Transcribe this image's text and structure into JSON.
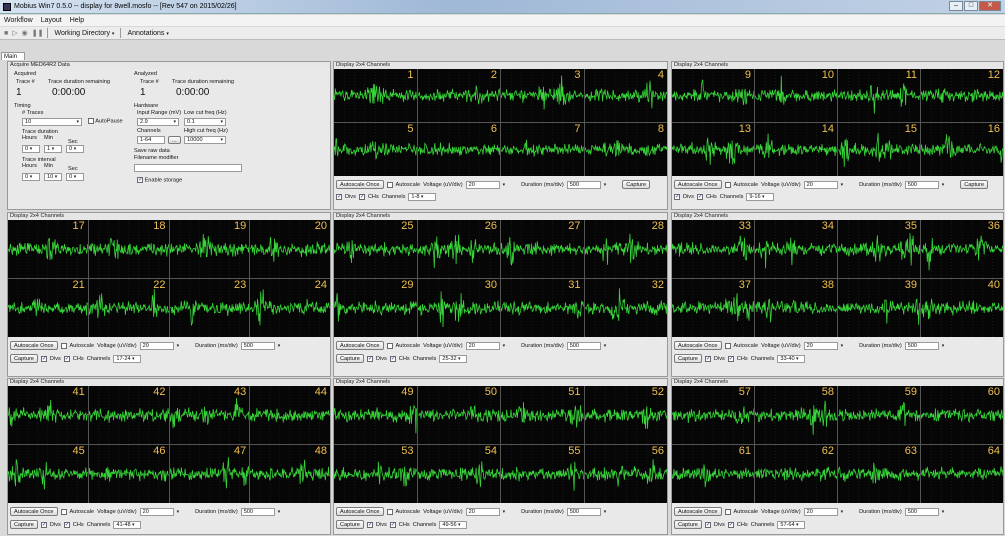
{
  "window": {
    "title": "Mobius Win7 0.5.0 -- display for 8well.mosfo -- [Rev 547 on 2015/02/26]"
  },
  "menu": [
    "Workflow",
    "Layout",
    "Help"
  ],
  "toolbar": {
    "working_directory": "Working Directory",
    "annotations": "Annotations"
  },
  "tab": "Main",
  "acquire": {
    "title": "Acquire MED64R2 Data",
    "acquired_label": "Acquired",
    "analyzed_label": "Analyzed",
    "trace_label": "Trace #",
    "duration_label": "Trace duration remaining",
    "acq_trace": "1",
    "acq_time": "0:00:00",
    "ana_trace": "1",
    "ana_time": "0:00:00",
    "timing_label": "Timing",
    "traces_label": "# Traces",
    "traces_value": "10",
    "autopause_label": "AutoPause",
    "trace_duration_label": "Trace duration",
    "hours_label": "Hours",
    "min_label": "Min",
    "sec_label": "Sec",
    "dur_hours": "0",
    "dur_min": "1",
    "dur_sec": "0",
    "interval_label": "Trace interval",
    "int_hours": "0",
    "int_min": "10",
    "int_sec": "0",
    "hardware_label": "Hardware",
    "input_range_label": "Input Range (mV)",
    "input_range_value": "2.9",
    "low_cut_label": "Low cut freq (Hz)",
    "low_cut_value": "0.1",
    "channels_label": "Channels",
    "channels_value": "1-64",
    "channels_btn": "...",
    "high_cut_label": "High cut freq (Hz)",
    "high_cut_value": "10000",
    "save_raw_label": "Save raw data",
    "filename_label": "Filename modifier",
    "filename_value": "",
    "enable_storage_label": "Enable storage"
  },
  "panel_common": {
    "title": "Display 2x4 Channels",
    "autoscale_once": "Autoscale Once",
    "autoscale": "Autoscale",
    "voltage_label": "Voltage (uV/div)",
    "voltage_value": "20",
    "duration_label": "Duration (ms/div)",
    "duration_value": "500",
    "capture": "Capture",
    "divs": "Divs",
    "chs": "CHs",
    "channels_label": "Channels"
  },
  "panels": [
    {
      "channels": "1-8",
      "nums": [
        "1",
        "2",
        "3",
        "4",
        "5",
        "6",
        "7",
        "8"
      ]
    },
    {
      "channels": "9-16",
      "nums": [
        "9",
        "10",
        "11",
        "12",
        "13",
        "14",
        "15",
        "16"
      ]
    },
    {
      "channels": "17-24",
      "nums": [
        "17",
        "18",
        "19",
        "20",
        "21",
        "22",
        "23",
        "24"
      ]
    },
    {
      "channels": "25-32",
      "nums": [
        "25",
        "26",
        "27",
        "28",
        "29",
        "30",
        "31",
        "32"
      ]
    },
    {
      "channels": "33-40",
      "nums": [
        "33",
        "34",
        "35",
        "36",
        "37",
        "38",
        "39",
        "40"
      ]
    },
    {
      "channels": "41-48",
      "nums": [
        "41",
        "42",
        "43",
        "44",
        "45",
        "46",
        "47",
        "48"
      ]
    },
    {
      "channels": "49-56",
      "nums": [
        "49",
        "50",
        "51",
        "52",
        "53",
        "54",
        "55",
        "56"
      ]
    },
    {
      "channels": "57-64",
      "nums": [
        "57",
        "58",
        "59",
        "60",
        "61",
        "62",
        "63",
        "64"
      ]
    }
  ],
  "colors": {
    "trace": "#38d63a",
    "channel_number": "#f0c050",
    "scope_bg": "#060606"
  }
}
